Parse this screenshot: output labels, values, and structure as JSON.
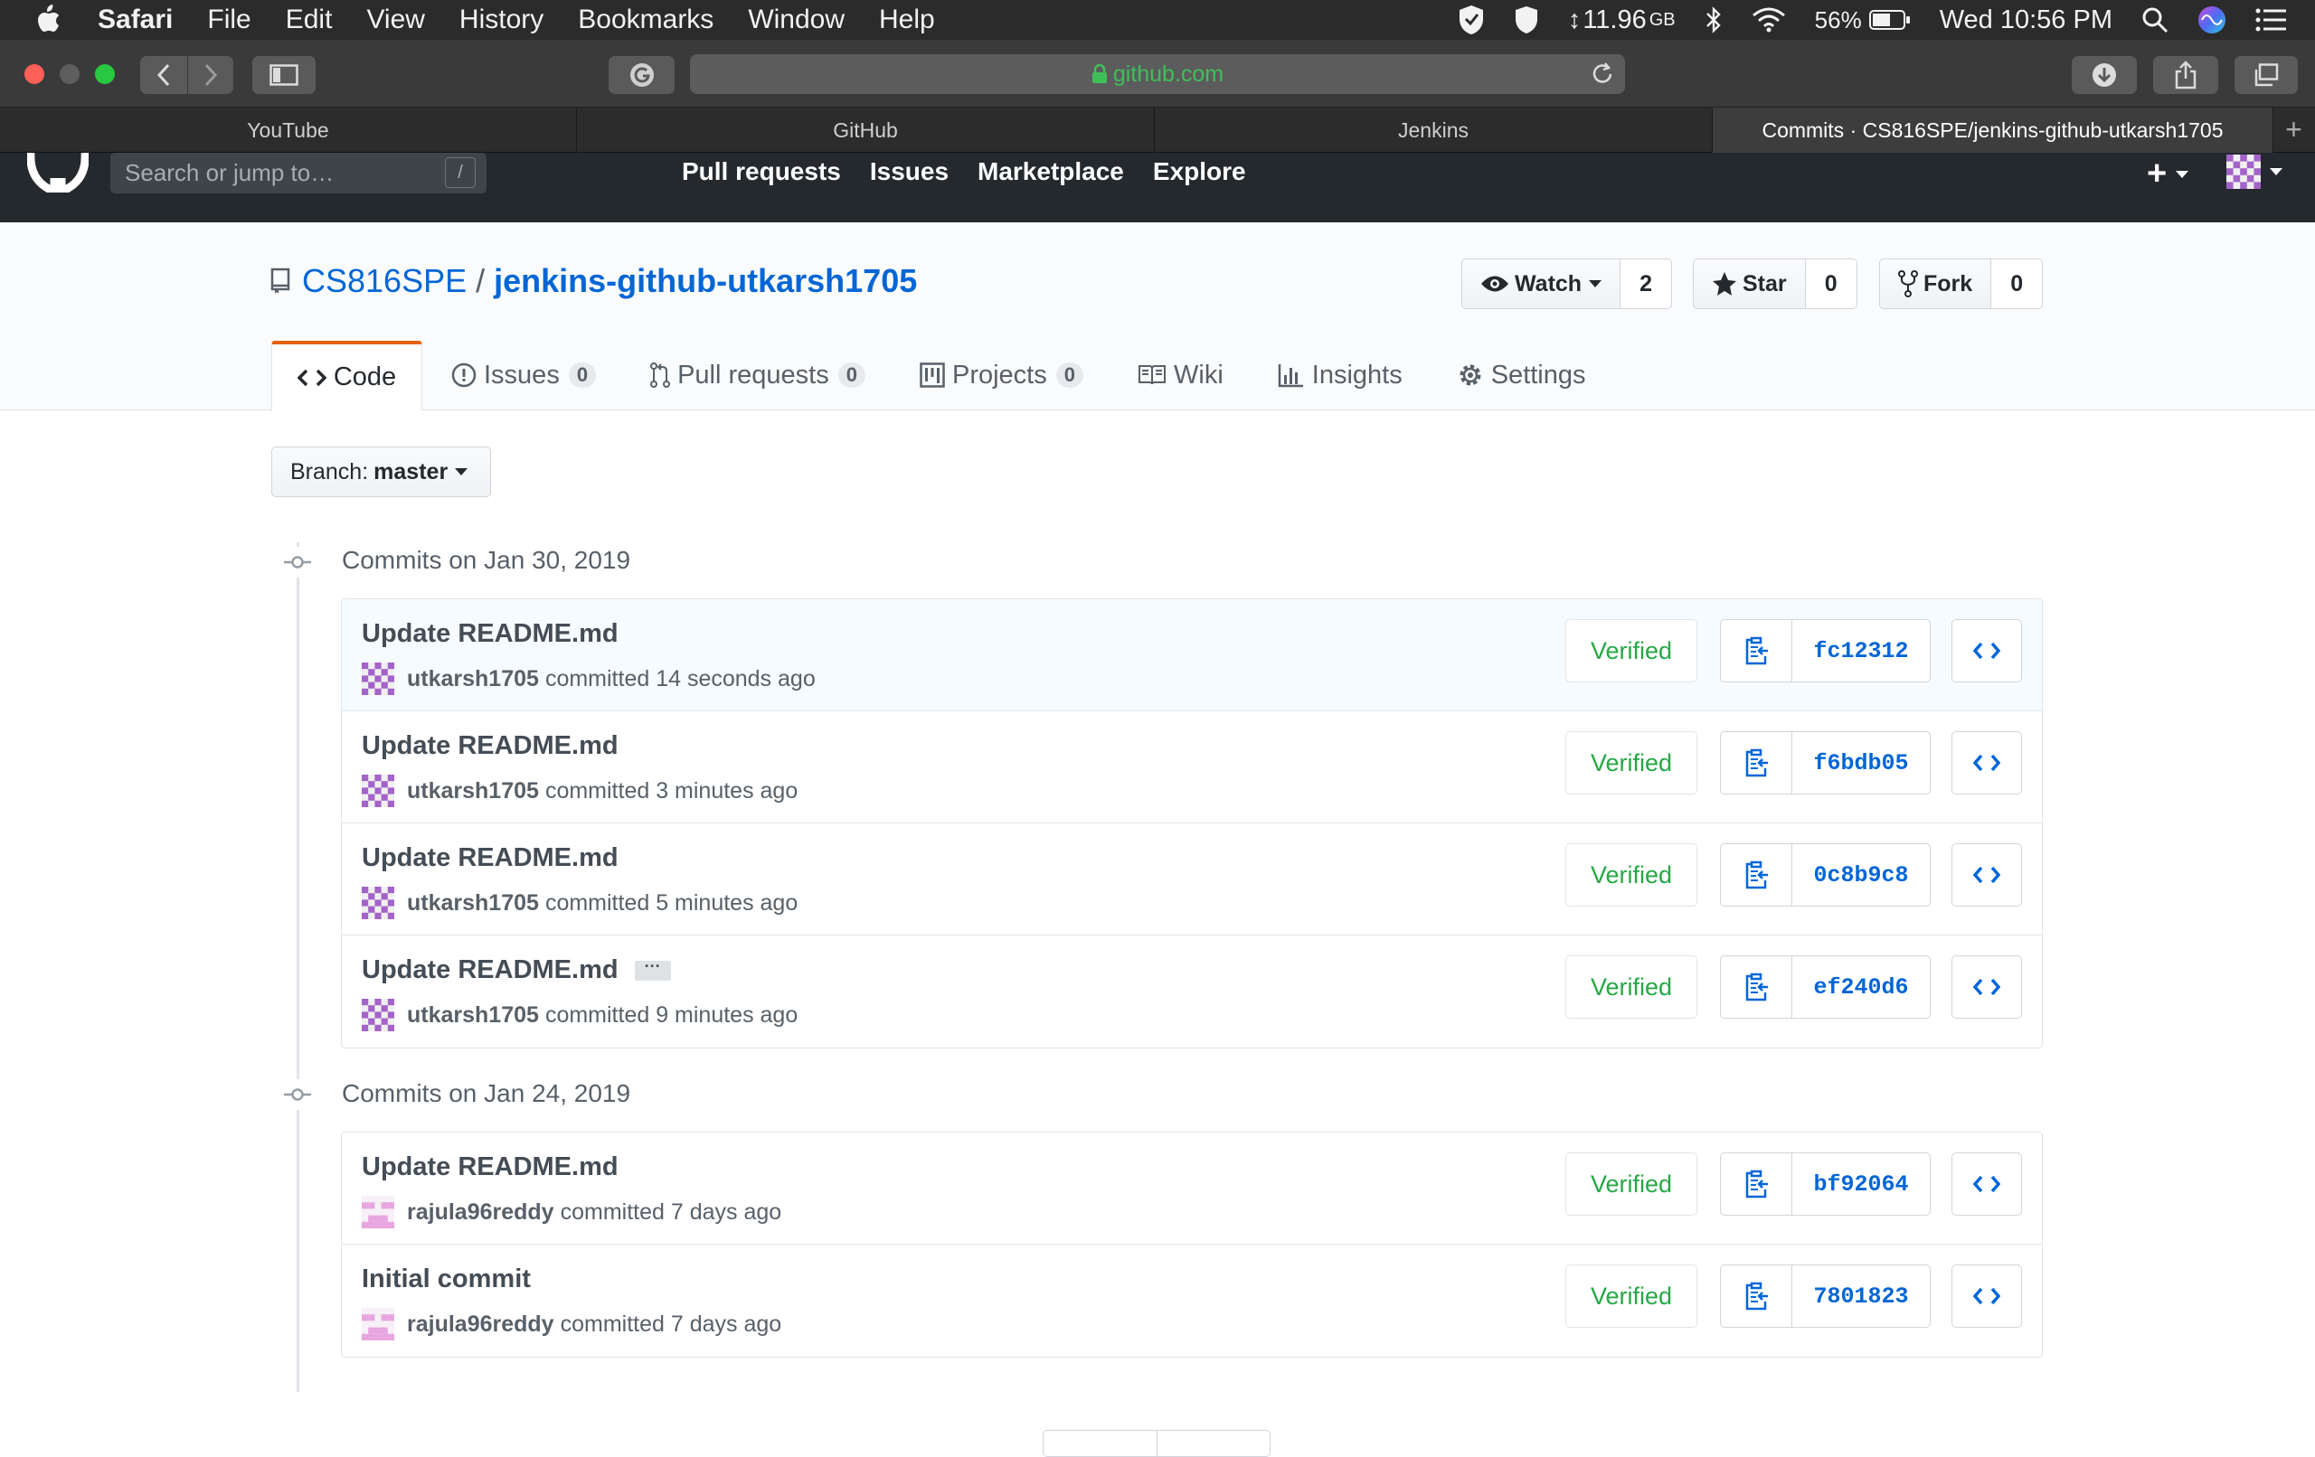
{
  "menubar": {
    "app": "Safari",
    "items": [
      "File",
      "Edit",
      "View",
      "History",
      "Bookmarks",
      "Window",
      "Help"
    ],
    "memory": "11.96",
    "memory_unit": "GB",
    "battery": "56%",
    "clock": "Wed 10:56 PM"
  },
  "browser": {
    "url": "github.com",
    "tabs": [
      {
        "label": "YouTube"
      },
      {
        "label": "GitHub"
      },
      {
        "label": "Jenkins"
      },
      {
        "label": "Commits · CS816SPE/jenkins-github-utkarsh1705"
      }
    ]
  },
  "github": {
    "search_placeholder": "Search or jump to…",
    "search_hotkey": "/",
    "nav": [
      "Pull requests",
      "Issues",
      "Marketplace",
      "Explore"
    ]
  },
  "repo": {
    "owner": "CS816SPE",
    "separator": "/",
    "name": "jenkins-github-utkarsh1705",
    "watch_label": "Watch",
    "watch_count": "2",
    "star_label": "Star",
    "star_count": "0",
    "fork_label": "Fork",
    "fork_count": "0",
    "tabs": {
      "code": "Code",
      "issues": "Issues",
      "issues_count": "0",
      "pulls": "Pull requests",
      "pulls_count": "0",
      "projects": "Projects",
      "projects_count": "0",
      "wiki": "Wiki",
      "insights": "Insights",
      "settings": "Settings"
    }
  },
  "branch": {
    "label": "Branch:",
    "value": "master"
  },
  "commit_groups": [
    {
      "title": "Commits on Jan 30, 2019",
      "commits": [
        {
          "message": "Update README.md",
          "author": "utkarsh1705",
          "time": "committed 14 seconds ago",
          "verified": "Verified",
          "sha": "fc12312"
        },
        {
          "message": "Update README.md",
          "author": "utkarsh1705",
          "time": "committed 3 minutes ago",
          "verified": "Verified",
          "sha": "f6bdb05"
        },
        {
          "message": "Update README.md",
          "author": "utkarsh1705",
          "time": "committed 5 minutes ago",
          "verified": "Verified",
          "sha": "0c8b9c8"
        },
        {
          "message": "Update README.md",
          "author": "utkarsh1705",
          "time": "committed 9 minutes ago",
          "verified": "Verified",
          "sha": "ef240d6",
          "expander": "···"
        }
      ]
    },
    {
      "title": "Commits on Jan 24, 2019",
      "commits": [
        {
          "message": "Update README.md",
          "author": "rajula96reddy",
          "time": "committed 7 days ago",
          "verified": "Verified",
          "sha": "bf92064"
        },
        {
          "message": "Initial commit",
          "author": "rajula96reddy",
          "time": "committed 7 days ago",
          "verified": "Verified",
          "sha": "7801823"
        }
      ]
    }
  ],
  "colors": {
    "link": "#0366d6",
    "verified": "#28a745",
    "header": "#24292e",
    "selected_tab_accent": "#e36209"
  }
}
